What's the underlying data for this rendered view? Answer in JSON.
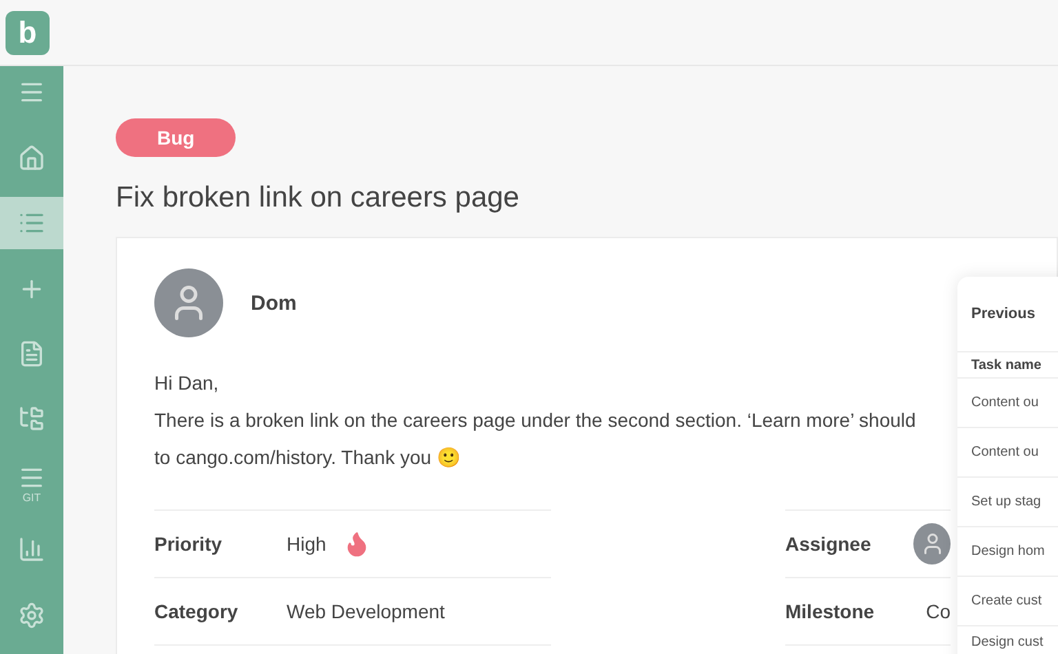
{
  "logo": {
    "letter": "b"
  },
  "sidebar": {
    "items": [
      {
        "kind": "menu",
        "selected": false
      },
      {
        "kind": "home",
        "selected": false
      },
      {
        "kind": "list",
        "selected": true
      },
      {
        "kind": "plus",
        "selected": false
      },
      {
        "kind": "doc",
        "selected": false
      },
      {
        "kind": "folder",
        "selected": false
      },
      {
        "kind": "git",
        "label": "GIT",
        "selected": false
      },
      {
        "kind": "chart",
        "selected": false
      },
      {
        "kind": "gear",
        "selected": false
      }
    ]
  },
  "issue": {
    "tag": "Bug",
    "title": "Fix broken link on careers page"
  },
  "message": {
    "author": "Dom",
    "lines": [
      "Hi Dan,",
      "There is a broken link on the careers page under the second section. ‘Learn more’ should",
      "to cango.com/history. Thank you 🙂"
    ]
  },
  "fields_left": [
    {
      "label": "Priority",
      "value": "High",
      "kind": "priority"
    },
    {
      "label": "Category",
      "value": "Web Development",
      "kind": "text"
    }
  ],
  "fields_right": [
    {
      "label": "Assignee",
      "kind": "avatar"
    },
    {
      "label": "Milestone",
      "value": "Co",
      "kind": "text"
    }
  ],
  "previous_panel": {
    "title": "Previous",
    "column": "Task name",
    "rows": [
      "Content ou",
      "Content ou",
      "Set up stag",
      "Design hom",
      "Create cust",
      "Design cust"
    ]
  }
}
